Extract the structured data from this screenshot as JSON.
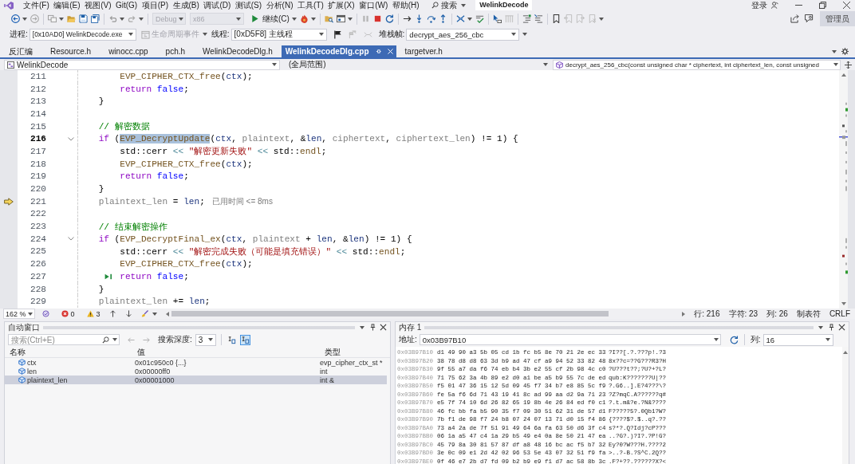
{
  "menu_bar": {
    "items": [
      "文件(F)",
      "编辑(E)",
      "视图(V)",
      "Git(G)",
      "项目(P)",
      "生成(B)",
      "调试(D)",
      "测试(S)",
      "分析(N)",
      "工具(T)",
      "扩展(X)",
      "窗口(W)",
      "帮助(H)"
    ],
    "search_label": "搜索",
    "title": "WelinkDecode",
    "sign_in": "登录"
  },
  "toolbar": {
    "configuration": {
      "value": "Debug",
      "disabled": true
    },
    "platform": {
      "value": "x86",
      "disabled": true
    },
    "continue_label": "继续(C)",
    "admin_label": "管理员"
  },
  "debug_location": {
    "process_label": "进程:",
    "process": "[0x10AD0] WelinkDecode.exe",
    "lifecycle": {
      "label": "生命周期事件",
      "disabled": true
    },
    "thread_label": "线程:",
    "thread": "[0xD5F8] 主线程",
    "stack_frame_label": "堆栈帧:",
    "stack_frame": "decrypt_aes_256_cbc"
  },
  "tabs": [
    {
      "label": "反汇编",
      "selected": false
    },
    {
      "label": "Resource.h",
      "selected": false
    },
    {
      "label": "winocc.cpp",
      "selected": false
    },
    {
      "label": "pch.h",
      "selected": false
    },
    {
      "label": "WelinkDecodeDlg.h",
      "selected": false
    },
    {
      "label": "WelinkDecodeDlg.cpp",
      "selected": true
    },
    {
      "label": "targetver.h",
      "selected": false
    }
  ],
  "navigation_bar": {
    "project": "WelinkDecode",
    "scope": "(全局范围)",
    "member": "decrypt_aes_256_cbc(const unsigned char * ciphertext, int ciphertext_len, const unsigned"
  },
  "editor": {
    "lines": [
      {
        "number": "211",
        "current": false,
        "fold": false,
        "next_statement": false,
        "run_to_click": false,
        "tokens": [
          {
            "kind": "func",
            "text": "        EVP_CIPHER_CTX_free"
          },
          {
            "kind": "plain",
            "text": "("
          },
          {
            "kind": "local",
            "text": "ctx"
          },
          {
            "kind": "plain",
            "text": ");"
          }
        ]
      },
      {
        "number": "212",
        "current": false,
        "fold": false,
        "next_statement": false,
        "run_to_click": false,
        "tokens": [
          {
            "kind": "control",
            "text": "        return"
          },
          {
            "kind": "keyword",
            "text": " false"
          },
          {
            "kind": "plain",
            "text": ";"
          }
        ]
      },
      {
        "number": "213",
        "current": false,
        "fold": false,
        "next_statement": false,
        "run_to_click": false,
        "tokens": [
          {
            "kind": "plain",
            "text": "    }"
          }
        ]
      },
      {
        "number": "214",
        "current": false,
        "fold": false,
        "next_statement": false,
        "run_to_click": false
      },
      {
        "number": "215",
        "current": false,
        "fold": false,
        "next_statement": false,
        "run_to_click": false,
        "tokens": [
          {
            "kind": "comment",
            "text": "    // 解密数据"
          }
        ]
      },
      {
        "number": "216",
        "current": true,
        "fold": true,
        "next_statement": false,
        "run_to_click": false,
        "tokens": [
          {
            "kind": "control",
            "text": "    if"
          },
          {
            "kind": "plain",
            "text": " ("
          },
          {
            "kind": "func",
            "text": "EVP_DecryptUpdate",
            "highlight": true
          },
          {
            "kind": "plain",
            "text": "("
          },
          {
            "kind": "local",
            "text": "ctx"
          },
          {
            "kind": "plain",
            "text": ", "
          },
          {
            "kind": "param",
            "text": "plaintext"
          },
          {
            "kind": "plain",
            "text": ", &"
          },
          {
            "kind": "local",
            "text": "len"
          },
          {
            "kind": "plain",
            "text": ", "
          },
          {
            "kind": "param",
            "text": "ciphertext"
          },
          {
            "kind": "plain",
            "text": ", "
          },
          {
            "kind": "param",
            "text": "ciphertext_len"
          },
          {
            "kind": "plain",
            "text": ") != 1) {"
          }
        ]
      },
      {
        "number": "217",
        "current": false,
        "fold": false,
        "next_statement": false,
        "run_to_click": false,
        "tokens": [
          {
            "kind": "plain",
            "text": "        std::cerr "
          },
          {
            "kind": "op",
            "text": "<<"
          },
          {
            "kind": "string",
            "text": " \"解密更新失败\""
          },
          {
            "kind": "op",
            "text": " <<"
          },
          {
            "kind": "plain",
            "text": " std::"
          },
          {
            "kind": "func",
            "text": "endl"
          },
          {
            "kind": "plain",
            "text": ";"
          }
        ]
      },
      {
        "number": "218",
        "current": false,
        "fold": false,
        "next_statement": false,
        "run_to_click": false,
        "tokens": [
          {
            "kind": "func",
            "text": "        EVP_CIPHER_CTX_free"
          },
          {
            "kind": "plain",
            "text": "("
          },
          {
            "kind": "local",
            "text": "ctx"
          },
          {
            "kind": "plain",
            "text": ");"
          }
        ]
      },
      {
        "number": "219",
        "current": false,
        "fold": false,
        "next_statement": false,
        "run_to_click": false,
        "tokens": [
          {
            "kind": "control",
            "text": "        return"
          },
          {
            "kind": "keyword",
            "text": " false"
          },
          {
            "kind": "plain",
            "text": ";"
          }
        ]
      },
      {
        "number": "220",
        "current": false,
        "fold": false,
        "next_statement": false,
        "run_to_click": false,
        "tokens": [
          {
            "kind": "plain",
            "text": "    }"
          }
        ]
      },
      {
        "number": "221",
        "current": false,
        "fold": false,
        "next_statement": true,
        "run_to_click": false,
        "tokens": [
          {
            "kind": "param",
            "text": "    plaintext_len"
          },
          {
            "kind": "plain",
            "text": " = "
          },
          {
            "kind": "local",
            "text": "len"
          },
          {
            "kind": "plain",
            "text": ";"
          }
        ],
        "tip": "已用时间 <= 8ms"
      },
      {
        "number": "222",
        "current": false,
        "fold": false,
        "next_statement": false,
        "run_to_click": false
      },
      {
        "number": "223",
        "current": false,
        "fold": false,
        "next_statement": false,
        "run_to_click": false,
        "tokens": [
          {
            "kind": "comment",
            "text": "    // 结束解密操作"
          }
        ]
      },
      {
        "number": "224",
        "current": false,
        "fold": true,
        "next_statement": false,
        "run_to_click": false,
        "tokens": [
          {
            "kind": "control",
            "text": "    if"
          },
          {
            "kind": "plain",
            "text": " ("
          },
          {
            "kind": "func",
            "text": "EVP_DecryptFinal_ex"
          },
          {
            "kind": "plain",
            "text": "("
          },
          {
            "kind": "local",
            "text": "ctx"
          },
          {
            "kind": "plain",
            "text": ", "
          },
          {
            "kind": "param",
            "text": "plaintext"
          },
          {
            "kind": "plain",
            "text": " + "
          },
          {
            "kind": "local",
            "text": "len"
          },
          {
            "kind": "plain",
            "text": ", &"
          },
          {
            "kind": "local",
            "text": "len"
          },
          {
            "kind": "plain",
            "text": ") != 1) {"
          }
        ]
      },
      {
        "number": "225",
        "current": false,
        "fold": false,
        "next_statement": false,
        "run_to_click": false,
        "tokens": [
          {
            "kind": "plain",
            "text": "        std::cerr "
          },
          {
            "kind": "op",
            "text": "<<"
          },
          {
            "kind": "string",
            "text": " \"解密完成失败（可能是填充错误）\""
          },
          {
            "kind": "op",
            "text": " <<"
          },
          {
            "kind": "plain",
            "text": " std::"
          },
          {
            "kind": "func",
            "text": "endl"
          },
          {
            "kind": "plain",
            "text": ";"
          }
        ]
      },
      {
        "number": "226",
        "current": false,
        "fold": false,
        "next_statement": false,
        "run_to_click": false,
        "tokens": [
          {
            "kind": "func",
            "text": "        EVP_CIPHER_CTX_free"
          },
          {
            "kind": "plain",
            "text": "("
          },
          {
            "kind": "local",
            "text": "ctx"
          },
          {
            "kind": "plain",
            "text": ");"
          }
        ]
      },
      {
        "number": "227",
        "current": false,
        "fold": false,
        "next_statement": false,
        "run_to_click": true,
        "tokens": [
          {
            "kind": "control",
            "text": "        return"
          },
          {
            "kind": "keyword",
            "text": " false"
          },
          {
            "kind": "plain",
            "text": ";"
          }
        ]
      },
      {
        "number": "228",
        "current": false,
        "fold": false,
        "next_statement": false,
        "run_to_click": false,
        "tokens": [
          {
            "kind": "plain",
            "text": "    }"
          }
        ]
      },
      {
        "number": "229",
        "current": false,
        "fold": false,
        "next_statement": false,
        "run_to_click": false,
        "tokens": [
          {
            "kind": "param",
            "text": "    plaintext_len"
          },
          {
            "kind": "plain",
            "text": " += "
          },
          {
            "kind": "local",
            "text": "len"
          },
          {
            "kind": "plain",
            "text": ";"
          }
        ]
      }
    ],
    "status": {
      "zoom": "162 %",
      "errors": "0",
      "warnings": "3",
      "position": [
        "行: 216",
        "字符: 23",
        "列: 26"
      ],
      "indentation": "制表符",
      "line_ending": "CRLF"
    }
  },
  "autos_window": {
    "title": "自动窗口",
    "search": {
      "placeholder": "搜索(Ctrl+E)"
    },
    "depth_label": "搜索深度:",
    "depth": "3",
    "view_buttons": [
      {
        "selected": false
      },
      {
        "selected": true
      }
    ],
    "columns": [
      "名称",
      "值",
      "类型"
    ],
    "rows": [
      {
        "name": "ctx",
        "value": "0x01c950c0 {...}",
        "type": "evp_cipher_ctx_st *",
        "selected": false
      },
      {
        "name": "len",
        "value": "0x00000ff0",
        "type": "int",
        "selected": false
      },
      {
        "name": "plaintext_len",
        "value": "0x00001000",
        "type": "int &",
        "selected": true
      }
    ]
  },
  "memory_window": {
    "title": "内存 1",
    "address_label": "地址:",
    "address": "0x03B97B10",
    "columns_label": "列:",
    "columns": "16",
    "rows": [
      {
        "address": "0x03B97B10",
        "bytes": "d1 49 90 a3 5b 05 cd 1b fc b5 8e 70 21 2e ec 33",
        "ascii": "?I??[.?.???p!.?3"
      },
      {
        "address": "0x03B97B20",
        "bytes": "38 78 d8 d8 63 3d b9 ad 47 cf a9 94 52 33 82 48",
        "ascii": "8x??c=??G???R3?H"
      },
      {
        "address": "0x03B97B30",
        "bytes": "9f 55 a7 da f6 74 eb b4 3b e2 55 cf 2b 98 4c c0",
        "ascii": "?U???t??;?U?+?L?"
      },
      {
        "address": "0x03B97B40",
        "bytes": "71 75 62 3a 4b 89 e2 d0 a1 be a5 b9 55 7c de ed",
        "ascii": "qub:K???????U|??"
      },
      {
        "address": "0x03B97B50",
        "bytes": "f5 01 47 36 15 12 5d 09 45 f7 34 b7 e8 85 5c f9",
        "ascii": "?.G6..].E?4???\\?"
      },
      {
        "address": "0x03B97B60",
        "bytes": "fe 5a f6 6d 71 43 19 41 8c ad 99 aa d2 9a 71 23",
        "ascii": "?Z?mqC.A??????q#"
      },
      {
        "address": "0x03B97B70",
        "bytes": "e5 7f 74 10 6d 26 82 65 19 8b 4e 26 84 ed f0 c1",
        "ascii": "?.t.m&?e.?N&????"
      },
      {
        "address": "0x03B97B80",
        "bytes": "46 fc bb fa b5 90 35 f7 09 30 51 62 31 de 57 d1",
        "ascii": "F?????5?.0Qb1?W?"
      },
      {
        "address": "0x03B97B90",
        "bytes": "7b f1 de 98 f7 24 b8 07 24 07 13 71 d0 15 f4 86",
        "ascii": "{????$?.$..q?.??"
      },
      {
        "address": "0x03B97BA0",
        "bytes": "73 a4 2a de 7f 51 91 49 64 6a fa 63 50 d6 3f c4",
        "ascii": "s?*?.Q?Idj?cP???"
      },
      {
        "address": "0x03B97BB0",
        "bytes": "06 1a a5 47 c4 1a 29 b5 49 e4 0a 8e 50 21 47 ea",
        "ascii": "..?G?.)?I?.?P!G?"
      },
      {
        "address": "0x03B97BC0",
        "bytes": "45 79 8a 30 81 57 87 df a8 48 16 bc ac f5 b7 32",
        "ascii": "Ey?0?W???H.????2"
      },
      {
        "address": "0x03B97BD0",
        "bytes": "3e 0c 09 e1 2d 42 02 96 53 5e 43 07 32 51 f9 fa",
        "ascii": ">..?-B.?S^C.2Q??"
      },
      {
        "address": "0x03B97BE0",
        "bytes": "0f 46 e7 2b d7 fd 09 b2 b9 e9 f1 d7 ac 58 8b 3c",
        "ascii": ".F?+??.??????X?<"
      }
    ]
  }
}
